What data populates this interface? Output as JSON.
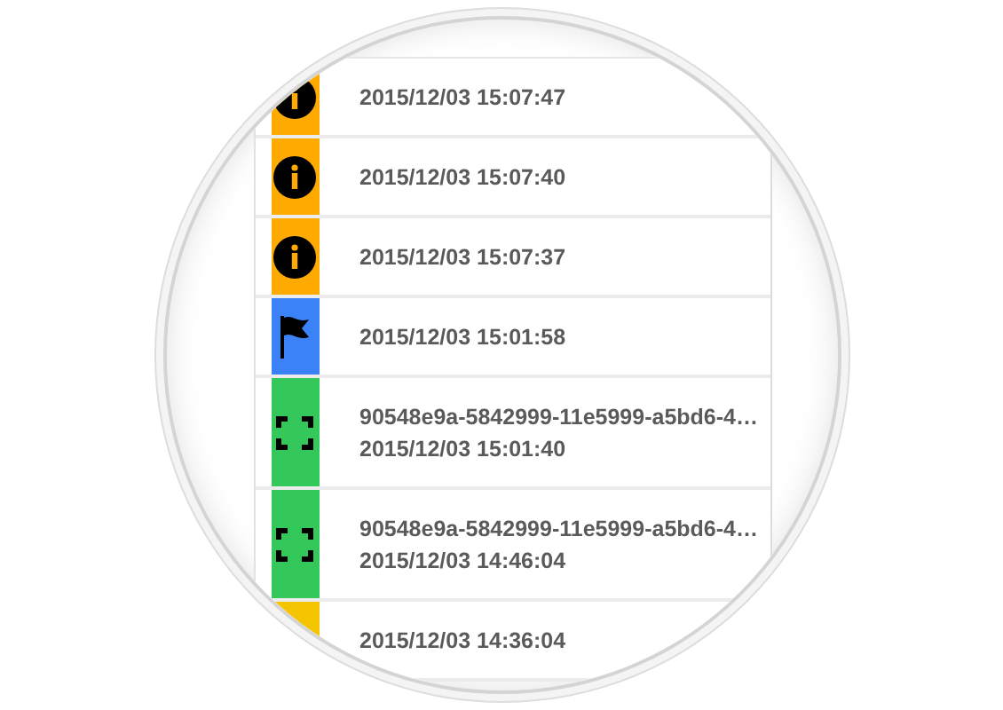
{
  "entries": [
    {
      "kind": "info",
      "color": "#ffaa00",
      "lines": [
        "2015/12/03 15:07:47"
      ]
    },
    {
      "kind": "info",
      "color": "#ffaa00",
      "lines": [
        "2015/12/03 15:07:40"
      ]
    },
    {
      "kind": "info",
      "color": "#ffaa00",
      "lines": [
        "2015/12/03 15:07:37"
      ]
    },
    {
      "kind": "flag",
      "color": "#3b82f6",
      "lines": [
        "2015/12/03 15:01:58"
      ]
    },
    {
      "kind": "scan",
      "color": "#34c759",
      "lines": [
        "90548e9a-5842999-11e5999-a5bd6-4…",
        "2015/12/03 15:01:40"
      ]
    },
    {
      "kind": "scan",
      "color": "#34c759",
      "lines": [
        "90548e9a-5842999-11e5999-a5bd6-4…",
        "2015/12/03 14:46:04"
      ]
    },
    {
      "color": "#f5c400",
      "lines": [
        "2015/12/03 14:36:04"
      ]
    }
  ]
}
